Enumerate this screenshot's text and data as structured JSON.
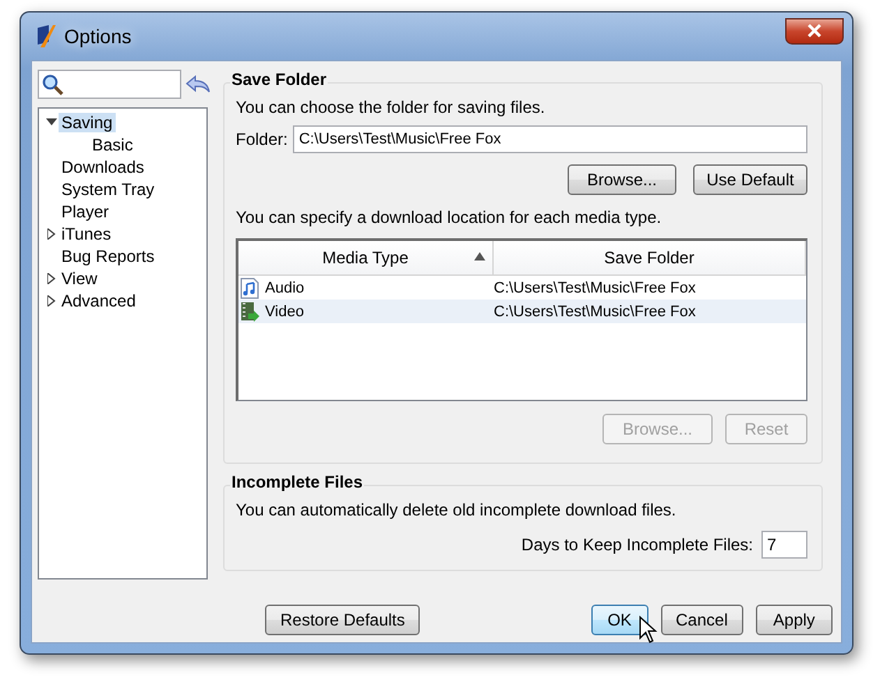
{
  "window": {
    "title": "Options"
  },
  "tree": [
    {
      "label": "Saving",
      "selected": true,
      "expanded": true,
      "children": [
        {
          "label": "Basic",
          "selected": false
        }
      ]
    },
    {
      "label": "Downloads",
      "selected": false
    },
    {
      "label": "System Tray",
      "selected": false
    },
    {
      "label": "Player",
      "selected": false
    },
    {
      "label": "iTunes",
      "selected": false,
      "expanded": false
    },
    {
      "label": "Bug Reports",
      "selected": false
    },
    {
      "label": "View",
      "selected": false,
      "expanded": false
    },
    {
      "label": "Advanced",
      "selected": false,
      "expanded": false
    }
  ],
  "save_folder": {
    "title": "Save Folder",
    "description": "You can choose the folder for saving files.",
    "folder_label": "Folder:",
    "folder_value": "C:\\Users\\Test\\Music\\Free Fox",
    "buttons": [
      {
        "label": "Browse...",
        "disabled": false
      },
      {
        "label": "Use Default",
        "disabled": false
      }
    ],
    "table_description": "You can specify a download location for each media type.",
    "table": {
      "columns": [
        {
          "label": "Media Type",
          "sorted": true
        },
        {
          "label": "Save Folder",
          "sorted": false
        }
      ],
      "rows": [
        {
          "kind": "audio",
          "media_type": "Audio",
          "save_folder": "C:\\Users\\Test\\Music\\Free Fox",
          "selected": false
        },
        {
          "kind": "video",
          "media_type": "Video",
          "save_folder": "C:\\Users\\Test\\Music\\Free Fox",
          "selected": true
        }
      ]
    },
    "table_buttons": [
      {
        "label": "Browse...",
        "disabled": true
      },
      {
        "label": "Reset",
        "disabled": true
      }
    ]
  },
  "incomplete_files": {
    "title": "Incomplete Files",
    "description": "You can automatically delete old incomplete download files.",
    "days_label": "Days to Keep Incomplete Files:",
    "days_value": "7"
  },
  "footer": {
    "restore_button": {
      "label": "Restore Defaults"
    },
    "buttons": [
      {
        "label": "OK",
        "default": true
      },
      {
        "label": "Cancel",
        "default": false
      },
      {
        "label": "Apply",
        "default": false
      }
    ]
  }
}
